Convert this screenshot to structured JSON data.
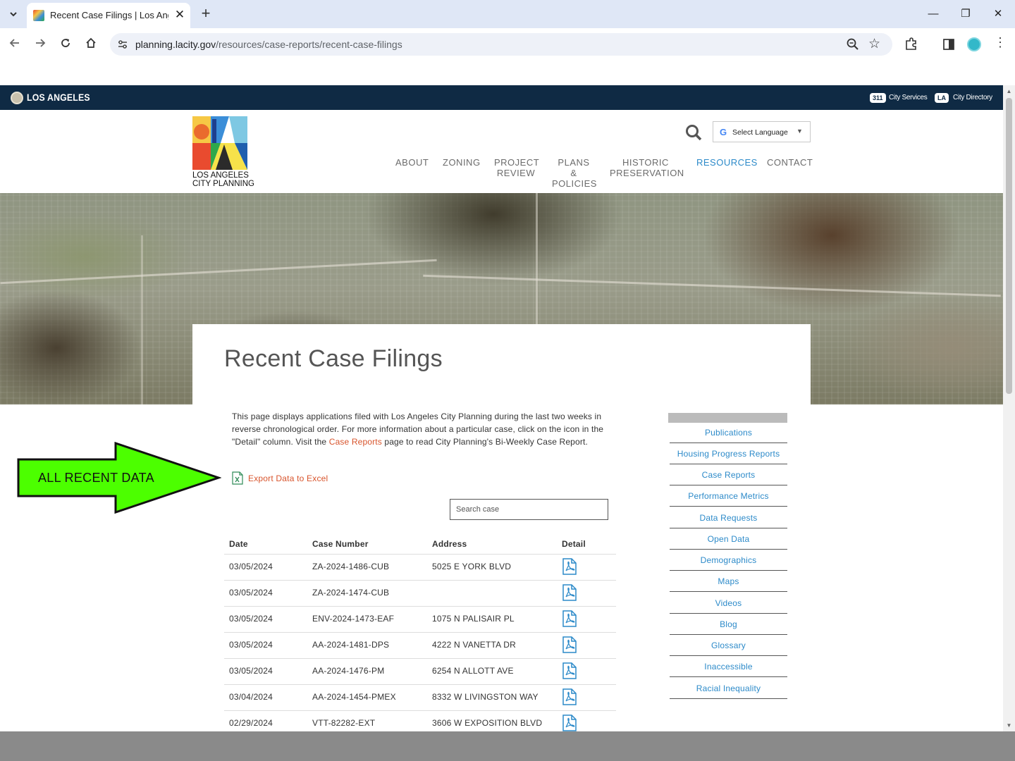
{
  "browser": {
    "tab_title": "Recent Case Filings | Los Angeles City Planning",
    "url_host": "planning.lacity.gov",
    "url_path": "/resources/case-reports/recent-case-filings",
    "new_tab": "+",
    "close_tab": "✕",
    "win_minimize": "—",
    "win_restore": "❐",
    "win_close": "✕"
  },
  "city_bar": {
    "name": "LOS ANGELES",
    "services_badge": "311",
    "services_label": "City Services",
    "directory_badge": "LA",
    "directory_label": "City Directory"
  },
  "header": {
    "logo_line1": "LOS ANGELES",
    "logo_line2": "CITY PLANNING",
    "language_label": "Select Language",
    "language_g": "G",
    "language_arrow": "▼",
    "nav": [
      {
        "label": "ABOUT"
      },
      {
        "label": "ZONING"
      },
      {
        "label": "PROJECT REVIEW"
      },
      {
        "label": "PLANS & POLICIES"
      },
      {
        "label": "HISTORIC PRESERVATION"
      },
      {
        "label": "RESOURCES"
      },
      {
        "label": "CONTACT"
      }
    ],
    "active_nav": "RESOURCES"
  },
  "page": {
    "title": "Recent Case Filings",
    "intro_before": "This page displays applications filed with Los Angeles City Planning during the last two weeks in reverse chronological order. For more information about a particular case, click on the icon in the \"Detail\" column. Visit the ",
    "intro_link": "Case Reports",
    "intro_after": " page to read City Planning's Bi-Weekly Case Report.",
    "export_label": "Export Data to Excel",
    "search_placeholder": "Search case"
  },
  "table": {
    "headers": [
      "Date",
      "Case Number",
      "Address",
      "Detail"
    ],
    "rows": [
      {
        "date": "03/05/2024",
        "case": "ZA-2024-1486-CUB",
        "address": "5025 E YORK BLVD"
      },
      {
        "date": "03/05/2024",
        "case": "ZA-2024-1474-CUB",
        "address": ""
      },
      {
        "date": "03/05/2024",
        "case": "ENV-2024-1473-EAF",
        "address": "1075 N PALISAIR PL"
      },
      {
        "date": "03/05/2024",
        "case": "AA-2024-1481-DPS",
        "address": "4222 N VANETTA DR"
      },
      {
        "date": "03/05/2024",
        "case": "AA-2024-1476-PM",
        "address": "6254 N ALLOTT AVE"
      },
      {
        "date": "03/04/2024",
        "case": "AA-2024-1454-PMEX",
        "address": "8332 W LIVINGSTON WAY"
      },
      {
        "date": "02/29/2024",
        "case": "VTT-82282-EXT",
        "address": "3606 W EXPOSITION BLVD"
      }
    ]
  },
  "sidebar": {
    "items": [
      {
        "label": "Publications"
      },
      {
        "label": "Housing Progress Reports"
      },
      {
        "label": "Case Reports"
      },
      {
        "label": "Performance Metrics"
      },
      {
        "label": "Data Requests"
      },
      {
        "label": "Open Data"
      },
      {
        "label": "Demographics"
      },
      {
        "label": "Maps"
      },
      {
        "label": "Videos"
      },
      {
        "label": "Blog"
      },
      {
        "label": "Glossary"
      },
      {
        "label": "Inaccessible"
      },
      {
        "label": "Racial Inequality"
      }
    ]
  },
  "annotation": {
    "label": "ALL RECENT DATA",
    "color": "#4cff00"
  },
  "colors": {
    "city_bar": "#0f2a44",
    "link_orange": "#d8542c",
    "link_blue": "#2c8ac9"
  }
}
